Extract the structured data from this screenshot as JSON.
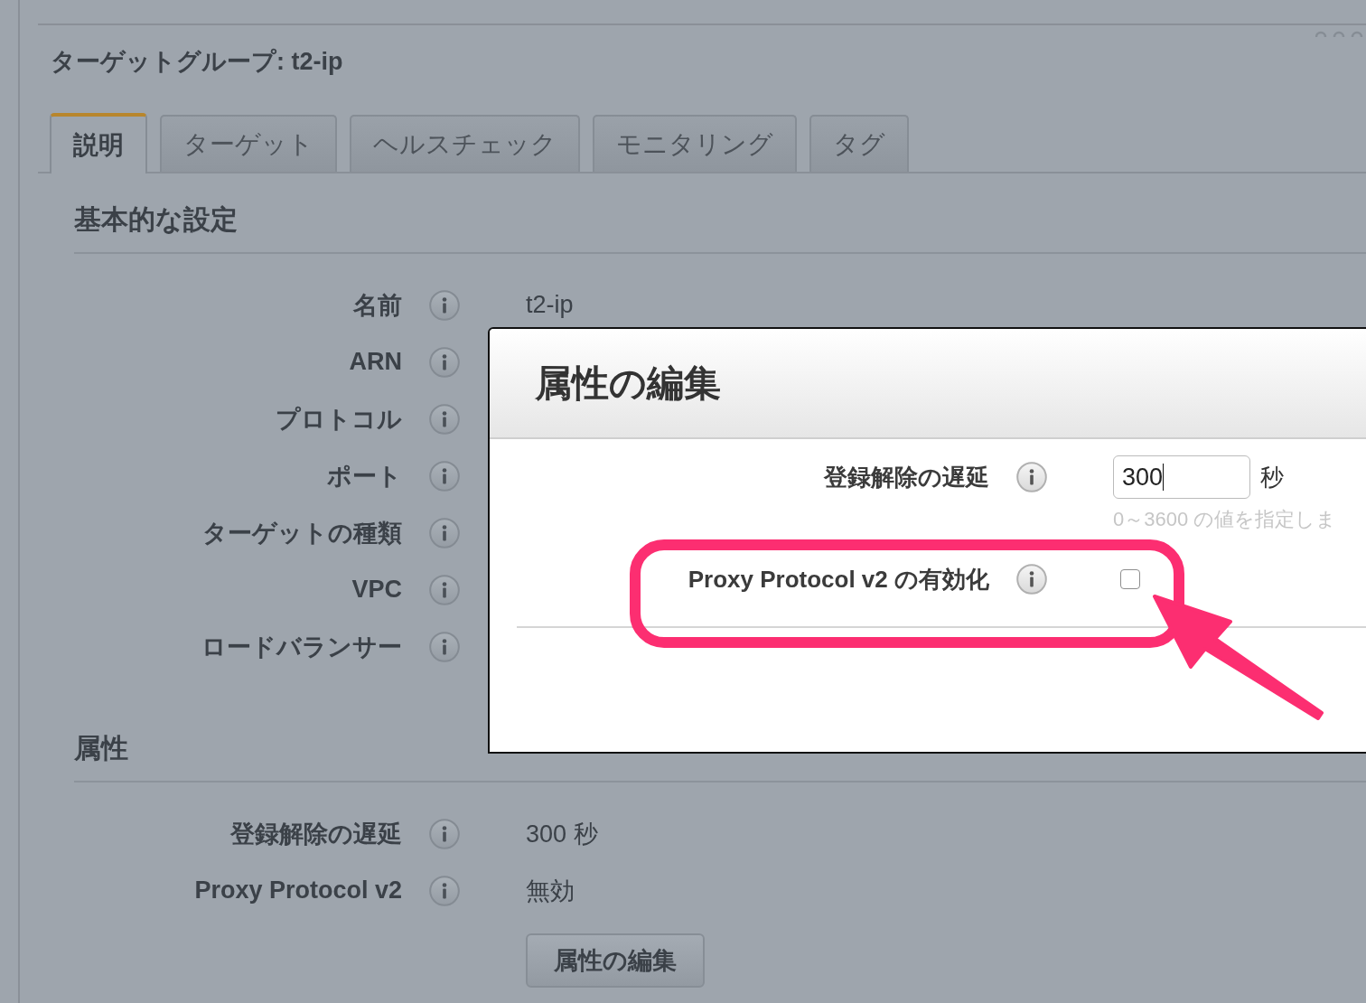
{
  "panel": {
    "title": "ターゲットグループ: t2-ip"
  },
  "tabs": [
    {
      "label": "説明",
      "selected": true
    },
    {
      "label": "ターゲット",
      "selected": false
    },
    {
      "label": "ヘルスチェック",
      "selected": false
    },
    {
      "label": "モニタリング",
      "selected": false
    },
    {
      "label": "タグ",
      "selected": false
    }
  ],
  "sections": [
    {
      "heading": "基本的な設定",
      "fields": [
        {
          "label": "名前",
          "value": "t2-ip"
        },
        {
          "label": "ARN"
        },
        {
          "label": "プロトコル"
        },
        {
          "label": "ポート"
        },
        {
          "label": "ターゲットの種類"
        },
        {
          "label": "VPC"
        },
        {
          "label": "ロードバランサー"
        }
      ]
    },
    {
      "heading": "属性",
      "fields": [
        {
          "label": "登録解除の遅延",
          "value": "300 秒"
        },
        {
          "label": "Proxy Protocol v2",
          "value": "無効"
        }
      ],
      "button": "属性の編集"
    }
  ],
  "dialog": {
    "title": "属性の編集",
    "fields": [
      {
        "kind": "number",
        "label": "登録解除の遅延",
        "value": "300",
        "unit": "秒",
        "hint": "0～3600 の値を指定しま"
      },
      {
        "kind": "checkbox",
        "label": "Proxy Protocol v2 の有効化",
        "checked": false
      }
    ]
  }
}
